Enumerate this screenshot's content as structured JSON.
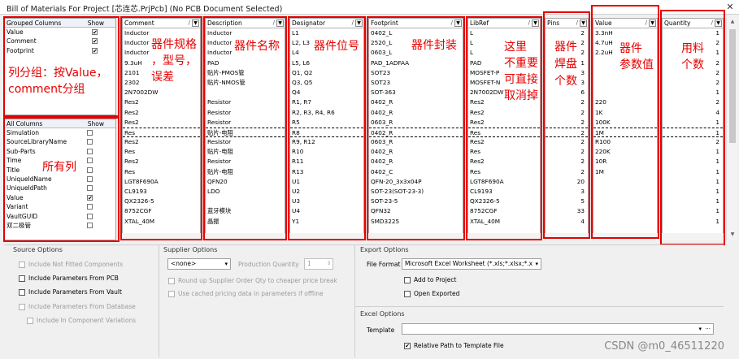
{
  "window": {
    "title": "Bill of Materials For Project [芯连芯.PrjPcb] (No PCB Document Selected)",
    "close_glyph": "✕"
  },
  "grouped_columns": {
    "header": "Grouped Columns",
    "show_header": "Show",
    "items": [
      {
        "label": "Value",
        "checked": "✔"
      },
      {
        "label": "Comment",
        "checked": "✔"
      },
      {
        "label": "Footprint",
        "checked": "✔"
      }
    ]
  },
  "all_columns": {
    "header": "All Columns",
    "show_header": "Show",
    "items": [
      {
        "label": "Simulation",
        "checked": ""
      },
      {
        "label": "SourceLibraryName",
        "checked": ""
      },
      {
        "label": "Sub-Parts",
        "checked": ""
      },
      {
        "label": "Time",
        "checked": ""
      },
      {
        "label": "Title",
        "checked": ""
      },
      {
        "label": "UniqueIdName",
        "checked": ""
      },
      {
        "label": "UniqueIdPath",
        "checked": ""
      },
      {
        "label": "Value",
        "checked": "✔"
      },
      {
        "label": "Variant",
        "checked": ""
      },
      {
        "label": "VaultGUID",
        "checked": ""
      },
      {
        "label": "双二极管",
        "checked": ""
      }
    ]
  },
  "table": {
    "columns": [
      {
        "key": "comment",
        "label": "Comment",
        "cells": [
          "Inductor",
          "Inductor",
          "Inductor",
          "9.3uH",
          "2101",
          "2302",
          "2N7002DW",
          "Res2",
          "Res2",
          "Res2",
          "Res",
          "Res2",
          "Res",
          "Res2",
          "Res",
          "LGT8F690A",
          "CL9193",
          "QX2326-5",
          "8752CGF",
          "XTAL_40M"
        ]
      },
      {
        "key": "description",
        "label": "Description",
        "cells": [
          "Inductor",
          "Inductor",
          "Inductor",
          "PAD",
          "贴片-PMOS管",
          "贴片-NMOS管",
          "",
          "Resistor",
          "Resistor",
          "Resistor",
          "贴片-电阻",
          "Resistor",
          "贴片-电阻",
          "Resistor",
          "贴片-电阻",
          "QFN20",
          "LDO",
          "",
          "蓝牙模块",
          "晶振"
        ]
      },
      {
        "key": "designator",
        "label": "Designator",
        "cells": [
          "L1",
          "L2, L3",
          "L4",
          "L5, L6",
          "Q1, Q2",
          "Q3, Q5",
          "Q4",
          "R1, R7",
          "R2, R3, R4, R6",
          "R5",
          "R8",
          "R9, R12",
          "R10",
          "R11",
          "R13",
          "U1",
          "U2",
          "U3",
          "U4",
          "Y1"
        ]
      },
      {
        "key": "footprint",
        "label": "Footprint",
        "cells": [
          "0402_L",
          "2520_L",
          "0603_L",
          "PAD_1ADFAA",
          "SOT23",
          "SOT23",
          "SOT-363",
          "0402_R",
          "0402_R",
          "0603_R",
          "0402_R",
          "0603_R",
          "0402_R",
          "0402_R",
          "0402_C",
          "QFN-20_3x3x04P",
          "SOT-23(SOT-23-3)",
          "SOT-23-5",
          "QFN32",
          "SMD3225"
        ]
      },
      {
        "key": "libref",
        "label": "LibRef",
        "cells": [
          "L",
          "L",
          "L",
          "PAD",
          "MOSFET-P",
          "MOSFET-N",
          "2N7002DW",
          "Res2",
          "Res2",
          "Res2",
          "Res",
          "Res2",
          "Res",
          "Res2",
          "Res",
          "LGT8F690A",
          "CL9193",
          "QX2326-5",
          "8752CGF",
          "XTAL_40M"
        ]
      },
      {
        "key": "pins",
        "label": "Pins",
        "cells": [
          "2",
          "2",
          "2",
          "1",
          "3",
          "3",
          "6",
          "2",
          "2",
          "2",
          "2",
          "2",
          "2",
          "2",
          "2",
          "20",
          "3",
          "5",
          "33",
          "4"
        ]
      },
      {
        "key": "value",
        "label": "Value",
        "cells": [
          "3.3nH",
          "4.7uH",
          "2.2uH",
          "",
          "",
          "",
          "",
          "220",
          "1K",
          "100K",
          "1M",
          "R100",
          "220K",
          "10R",
          "1M",
          "",
          "",
          "",
          "",
          ""
        ]
      },
      {
        "key": "quantity",
        "label": "Quantity",
        "cells": [
          "1",
          "2",
          "1",
          "2",
          "2",
          "2",
          "1",
          "2",
          "4",
          "1",
          "1",
          "2",
          "1",
          "1",
          "1",
          "1",
          "1",
          "1",
          "1",
          "1"
        ]
      }
    ]
  },
  "annotations": {
    "grouped": "列分组：按Value，\ncomment分组",
    "all_cols": "所有列",
    "comment": "器件规格\n，型号，\n误差",
    "description": "器件名称",
    "designator": "器件位号",
    "footprint": "器件封装",
    "libref": "这里\n不重要\n可直接\n取消掉",
    "pins": "器件\n焊盘\n个数",
    "value": "器件\n参数值",
    "quantity": "用料\n个数"
  },
  "source_options": {
    "title": "Source Options",
    "items": [
      {
        "label": "Include Not Fitted Components",
        "enabled": false
      },
      {
        "label": "Include Parameters From PCB",
        "enabled": true
      },
      {
        "label": "Include Parameters From Vault",
        "enabled": true
      },
      {
        "label": "Include Parameters From Database",
        "enabled": false
      },
      {
        "label": "Include In Component Variations",
        "enabled": false
      }
    ]
  },
  "supplier_options": {
    "title": "Supplier Options",
    "supplier_value": "<none>",
    "production_qty_label": "Production Quantity",
    "production_qty_value": "1",
    "round_up_label": "Round up Supplier Order Qty to cheaper price break",
    "cached_label": "Use cached pricing data in parameters if offline"
  },
  "export_options": {
    "title": "Export Options",
    "file_format_label": "File Format",
    "file_format_value": "Microsoft Excel Worksheet (*.xls;*.xlsx;*.x",
    "add_to_project": "Add to Project",
    "open_exported": "Open Exported"
  },
  "excel_options": {
    "title": "Excel Options",
    "template_label": "Template",
    "template_value": "",
    "relative_path": "Relative Path to Template File",
    "relative_checked": "✔"
  },
  "watermark": "CSDN @m0_46511220"
}
